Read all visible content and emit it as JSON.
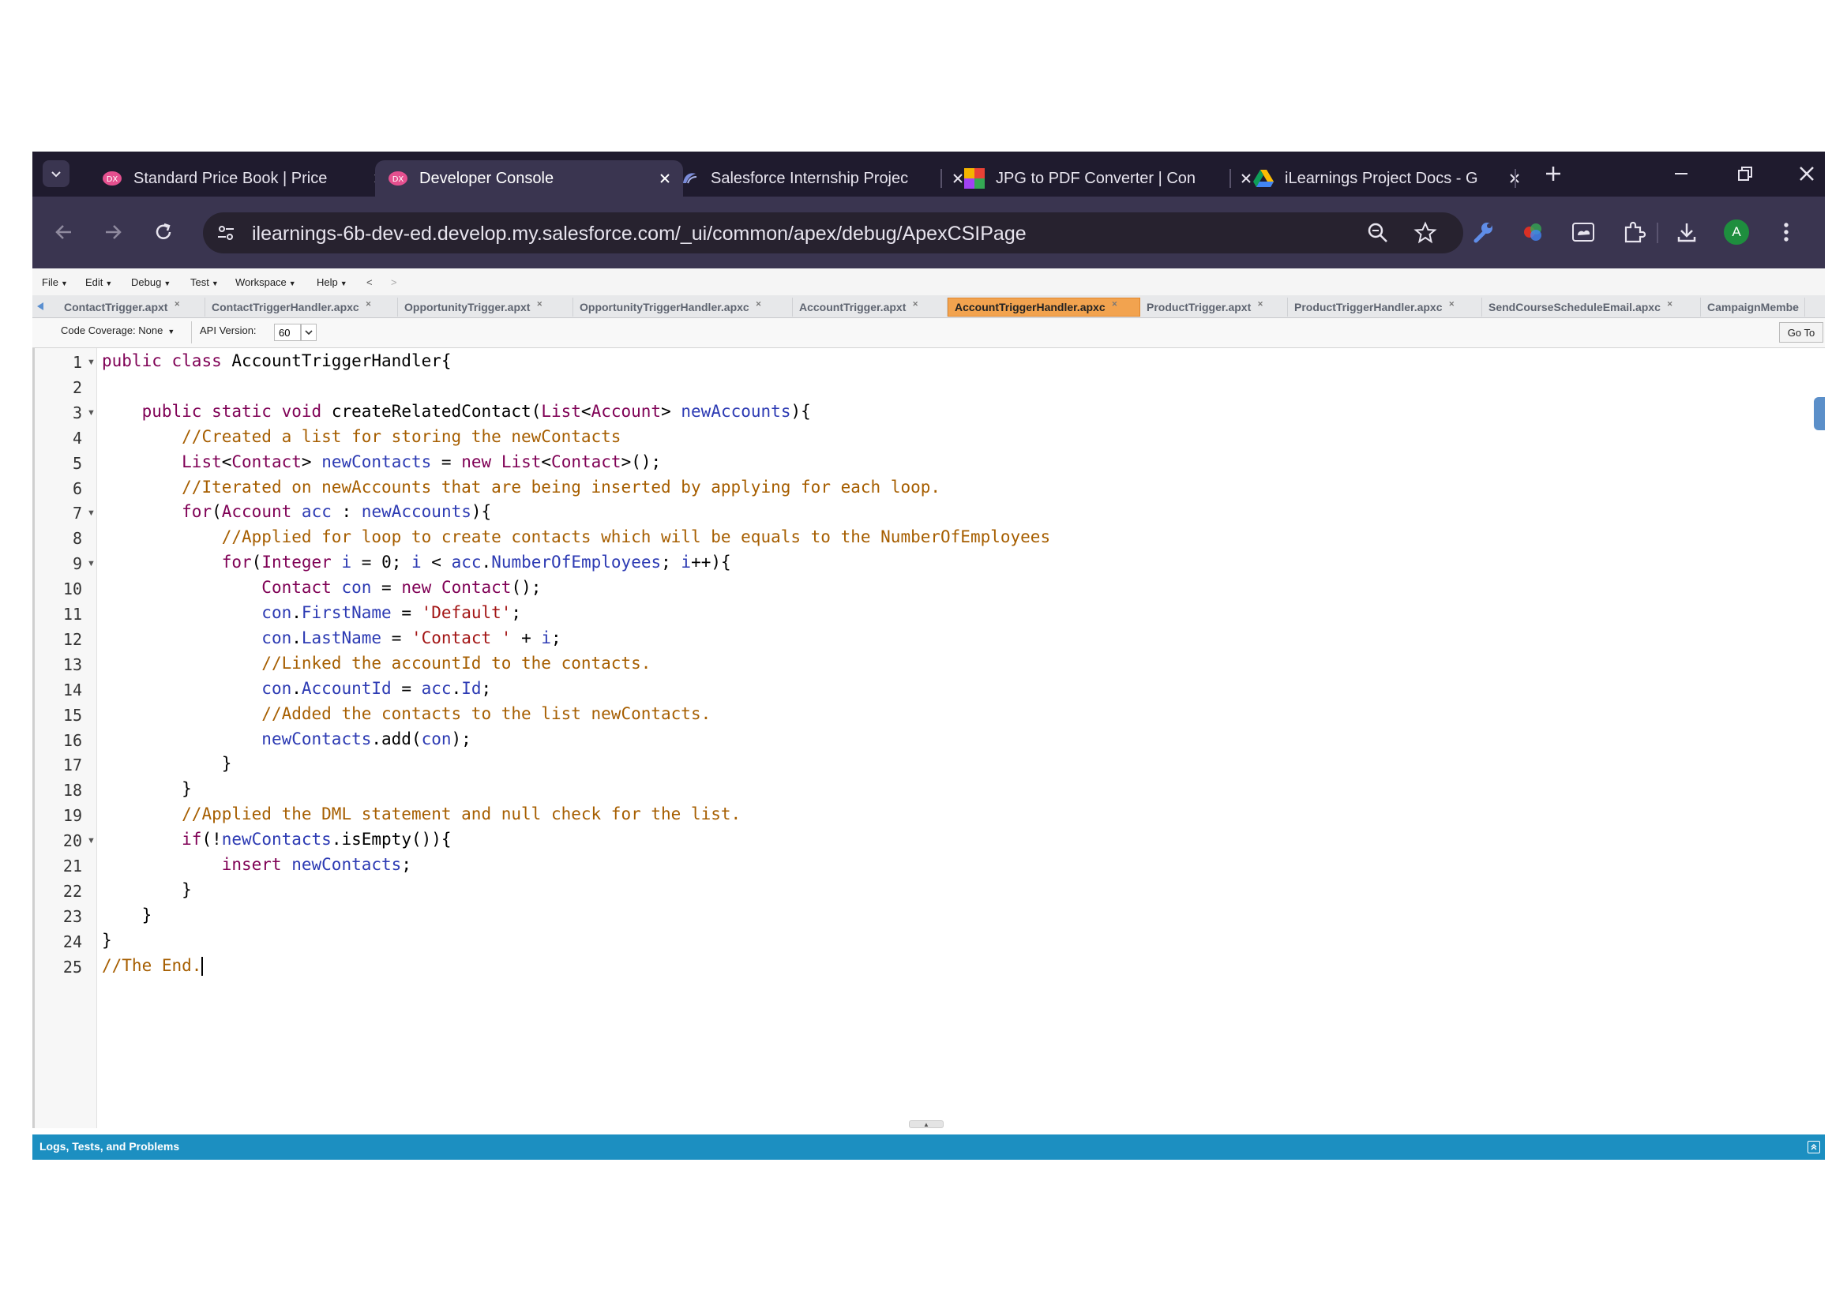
{
  "browser": {
    "tabs": [
      {
        "title": "Standard Price Book | Price",
        "active": false
      },
      {
        "title": "Developer Console",
        "active": true
      },
      {
        "title": "Salesforce Internship Projec",
        "active": false
      },
      {
        "title": "JPG to PDF Converter | Con",
        "active": false
      },
      {
        "title": "iLearnings Project Docs - G",
        "active": false
      }
    ],
    "url": "ilearnings-6b-dev-ed.develop.my.salesforce.com/_ui/common/apex/debug/ApexCSIPage",
    "profile_initial": "A",
    "colors": {
      "frame": "#1f1b2e",
      "toolbar": "#3a3550",
      "profile": "#1e8e3e"
    }
  },
  "console": {
    "menus": [
      "File",
      "Edit",
      "Debug",
      "Test",
      "Workspace",
      "Help",
      "<",
      ">"
    ],
    "file_tabs": [
      {
        "label": "ContactTrigger.apxt",
        "active": false
      },
      {
        "label": "ContactTriggerHandler.apxc",
        "active": false
      },
      {
        "label": "OpportunityTrigger.apxt",
        "active": false
      },
      {
        "label": "OpportunityTriggerHandler.apxc",
        "active": false
      },
      {
        "label": "AccountTrigger.apxt",
        "active": false
      },
      {
        "label": "AccountTriggerHandler.apxc",
        "active": true
      },
      {
        "label": "ProductTrigger.apxt",
        "active": false
      },
      {
        "label": "ProductTriggerHandler.apxc",
        "active": false
      },
      {
        "label": "SendCourseScheduleEmail.apxc",
        "active": false
      },
      {
        "label": "CampaignMembe",
        "active": false
      }
    ],
    "code_coverage": "Code Coverage: None",
    "api_version_label": "API Version:",
    "api_version": "60",
    "goto_label": "Go To",
    "footer_label": "Logs, Tests, and Problems",
    "colors": {
      "active_tab": "#f2a34f",
      "footer": "#1c8fc1"
    }
  },
  "code": {
    "line_numbers": [
      "1",
      "2",
      "3",
      "4",
      "5",
      "6",
      "7",
      "8",
      "9",
      "10",
      "11",
      "12",
      "13",
      "14",
      "15",
      "16",
      "17",
      "18",
      "19",
      "20",
      "21",
      "22",
      "23",
      "24",
      "25"
    ],
    "lines": [
      "public class AccountTriggerHandler{",
      "",
      "    public static void createRelatedContact(List<Account> newAccounts){",
      "        //Created a list for storing the newContacts",
      "        List<Contact> newContacts = new List<Contact>();",
      "        //Iterated on newAccounts that are being inserted by applying for each loop.",
      "        for(Account acc : newAccounts){",
      "            //Applied for loop to create contacts which will be equals to the NumberOfEmployees",
      "            for(Integer i = 0; i < acc.NumberOfEmployees; i++){",
      "                Contact con = new Contact();",
      "                con.FirstName = 'Default';",
      "                con.LastName = 'Contact ' + i;",
      "                //Linked the accountId to the contacts.",
      "                con.AccountId = acc.Id;",
      "                //Added the contacts to the list newContacts.",
      "                newContacts.add(con);",
      "            }",
      "        }",
      "        //Applied the DML statement and null check for the list.",
      "        if(!newContacts.isEmpty()){",
      "            insert newContacts;",
      "        }",
      "    }",
      "}",
      "//The End."
    ],
    "fold_lines": [
      "1",
      "3",
      "7",
      "9",
      "20"
    ]
  }
}
